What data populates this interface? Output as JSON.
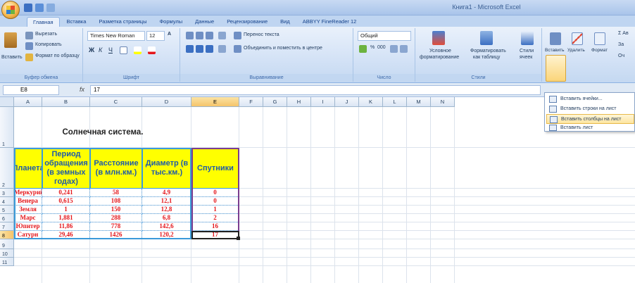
{
  "window": {
    "title": "Книга1 - Microsoft Excel"
  },
  "tabs": [
    "Главная",
    "Вставка",
    "Разметка страницы",
    "Формулы",
    "Данные",
    "Рецензирование",
    "Вид",
    "ABBYY FineReader 12"
  ],
  "clipboard": {
    "paste": "Вставить",
    "cut": "Вырезать",
    "copy": "Копировать",
    "format_painter": "Формат по образцу",
    "label": "Буфер обмена"
  },
  "font": {
    "name": "Times New Roman",
    "size": "12",
    "label": "Шрифт"
  },
  "alignment": {
    "wrap": "Перенос текста",
    "merge": "Объединить и поместить в центре",
    "label": "Выравнивание"
  },
  "number": {
    "format": "Общий",
    "label": "Число"
  },
  "styles": {
    "conditional": "Условное",
    "conditional2": "форматирование",
    "format_table": "Форматировать",
    "format_table2": "как таблицу",
    "cell_styles": "Стили",
    "cell_styles2": "ячеек",
    "label": "Стили"
  },
  "cells": {
    "insert": "Вставить",
    "delete": "Удалить",
    "format": "Формат"
  },
  "editing": {
    "sum": "Σ Ав",
    "fill": "За",
    "clear": "Оч"
  },
  "formula_bar": {
    "name_box": "E8",
    "fx": "fx",
    "value": "17"
  },
  "columns": [
    "A",
    "B",
    "C",
    "D",
    "E",
    "F",
    "G",
    "H",
    "I",
    "J",
    "K",
    "L",
    "M",
    "N"
  ],
  "rows": [
    "1",
    "2",
    "3",
    "4",
    "5",
    "6",
    "7",
    "8",
    "9",
    "10",
    "11"
  ],
  "insert_menu": [
    "Вставить ячейки...",
    "Вставить строки на лист",
    "Вставить столбцы на лист",
    "Вставить лист"
  ],
  "table": {
    "title": "Солнечная система.",
    "headers": [
      "Планета",
      "Период обращения (в земных годах)",
      "Расстояние (в млн.км.)",
      "Диаметр (в тыс.км.)",
      "Спутники"
    ],
    "rows": [
      [
        "Меркурий",
        "0,241",
        "58",
        "4,9",
        "0"
      ],
      [
        "Венера",
        "0,615",
        "108",
        "12,1",
        "0"
      ],
      [
        "Земля",
        "1",
        "150",
        "12,8",
        "1"
      ],
      [
        "Марс",
        "1,881",
        "288",
        "6,8",
        "2"
      ],
      [
        "Юпитер",
        "11,86",
        "778",
        "142,6",
        "16"
      ],
      [
        "Сатурн",
        "29,46",
        "1426",
        "120,2",
        "17"
      ]
    ]
  }
}
